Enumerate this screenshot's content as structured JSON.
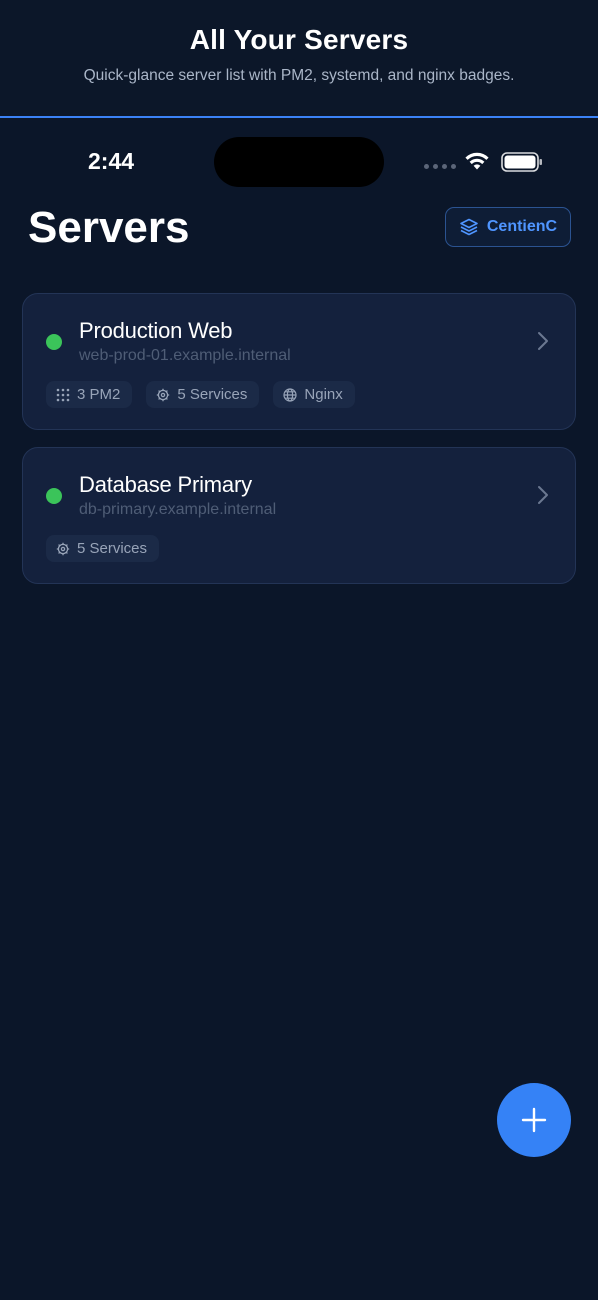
{
  "promo": {
    "title": "All Your Servers",
    "subtitle": "Quick-glance server list with PM2, systemd, and nginx badges."
  },
  "status_bar": {
    "time": "2:44",
    "icons": [
      "cellular-icon",
      "wifi-icon",
      "battery-icon"
    ]
  },
  "header": {
    "title": "Servers",
    "brand_button_label": "CentienC",
    "brand_icon": "layers-icon"
  },
  "servers": [
    {
      "name": "Production Web",
      "host": "web-prod-01.example.internal",
      "status_color": "#3bc45a",
      "badges": [
        {
          "icon": "grid-icon",
          "label": "3 PM2"
        },
        {
          "icon": "gear-icon",
          "label": "5 Services"
        },
        {
          "icon": "globe-icon",
          "label": "Nginx"
        }
      ]
    },
    {
      "name": "Database Primary",
      "host": "db-primary.example.internal",
      "status_color": "#3bc45a",
      "badges": [
        {
          "icon": "gear-icon",
          "label": "5 Services"
        }
      ]
    }
  ],
  "fab": {
    "icon": "plus-icon"
  },
  "colors": {
    "background": "#0b1629",
    "card": "#14213d",
    "accent": "#3582f6",
    "online": "#3bc45a"
  }
}
